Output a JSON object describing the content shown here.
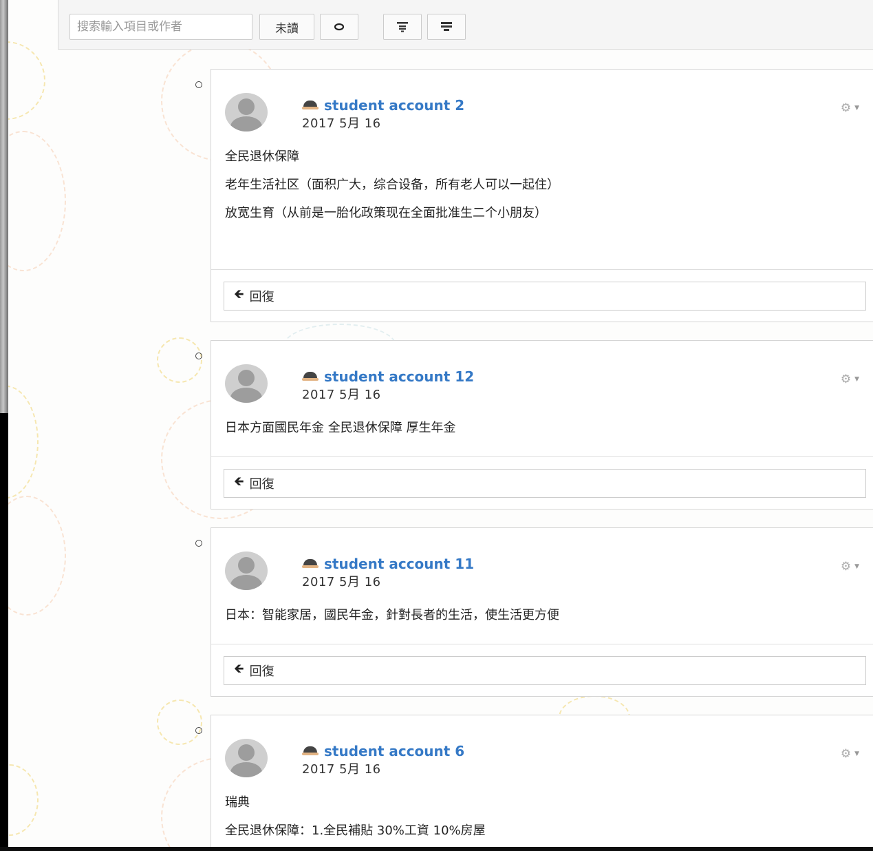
{
  "toolbar": {
    "search_placeholder": "搜索輸入項目或作者",
    "unread_label": "未讀",
    "eye_icon": "eye-icon",
    "expand_icon": "expand-all-icon",
    "collapse_icon": "collapse-all-icon"
  },
  "posts": [
    {
      "author": "student account 2",
      "date": "2017 5月 16",
      "lines": [
        "全民退休保障",
        "老年生活社区（面积广大，综合设备，所有老人可以一起住）",
        "放宽生育（从前是一胎化政策现在全面批准生二个小朋友）"
      ],
      "reply_label": "回復"
    },
    {
      "author": "student account 12",
      "date": "2017 5月 16",
      "lines": [
        "日本方面國民年金 全民退休保障 厚生年金"
      ],
      "reply_label": "回復"
    },
    {
      "author": "student account 11",
      "date": "2017 5月 16",
      "lines": [
        "日本：智能家居，國民年金，針對長者的生活，使生活更方便"
      ],
      "reply_label": "回復"
    },
    {
      "author": "student account 6",
      "date": "2017 5月 16",
      "lines": [
        "瑞典",
        "全民退休保障：1.全民補貼 30%工資 10%房屋"
      ],
      "reply_label": ""
    }
  ],
  "colors": {
    "author_link": "#3579c6",
    "background": "#fdfdfc"
  }
}
